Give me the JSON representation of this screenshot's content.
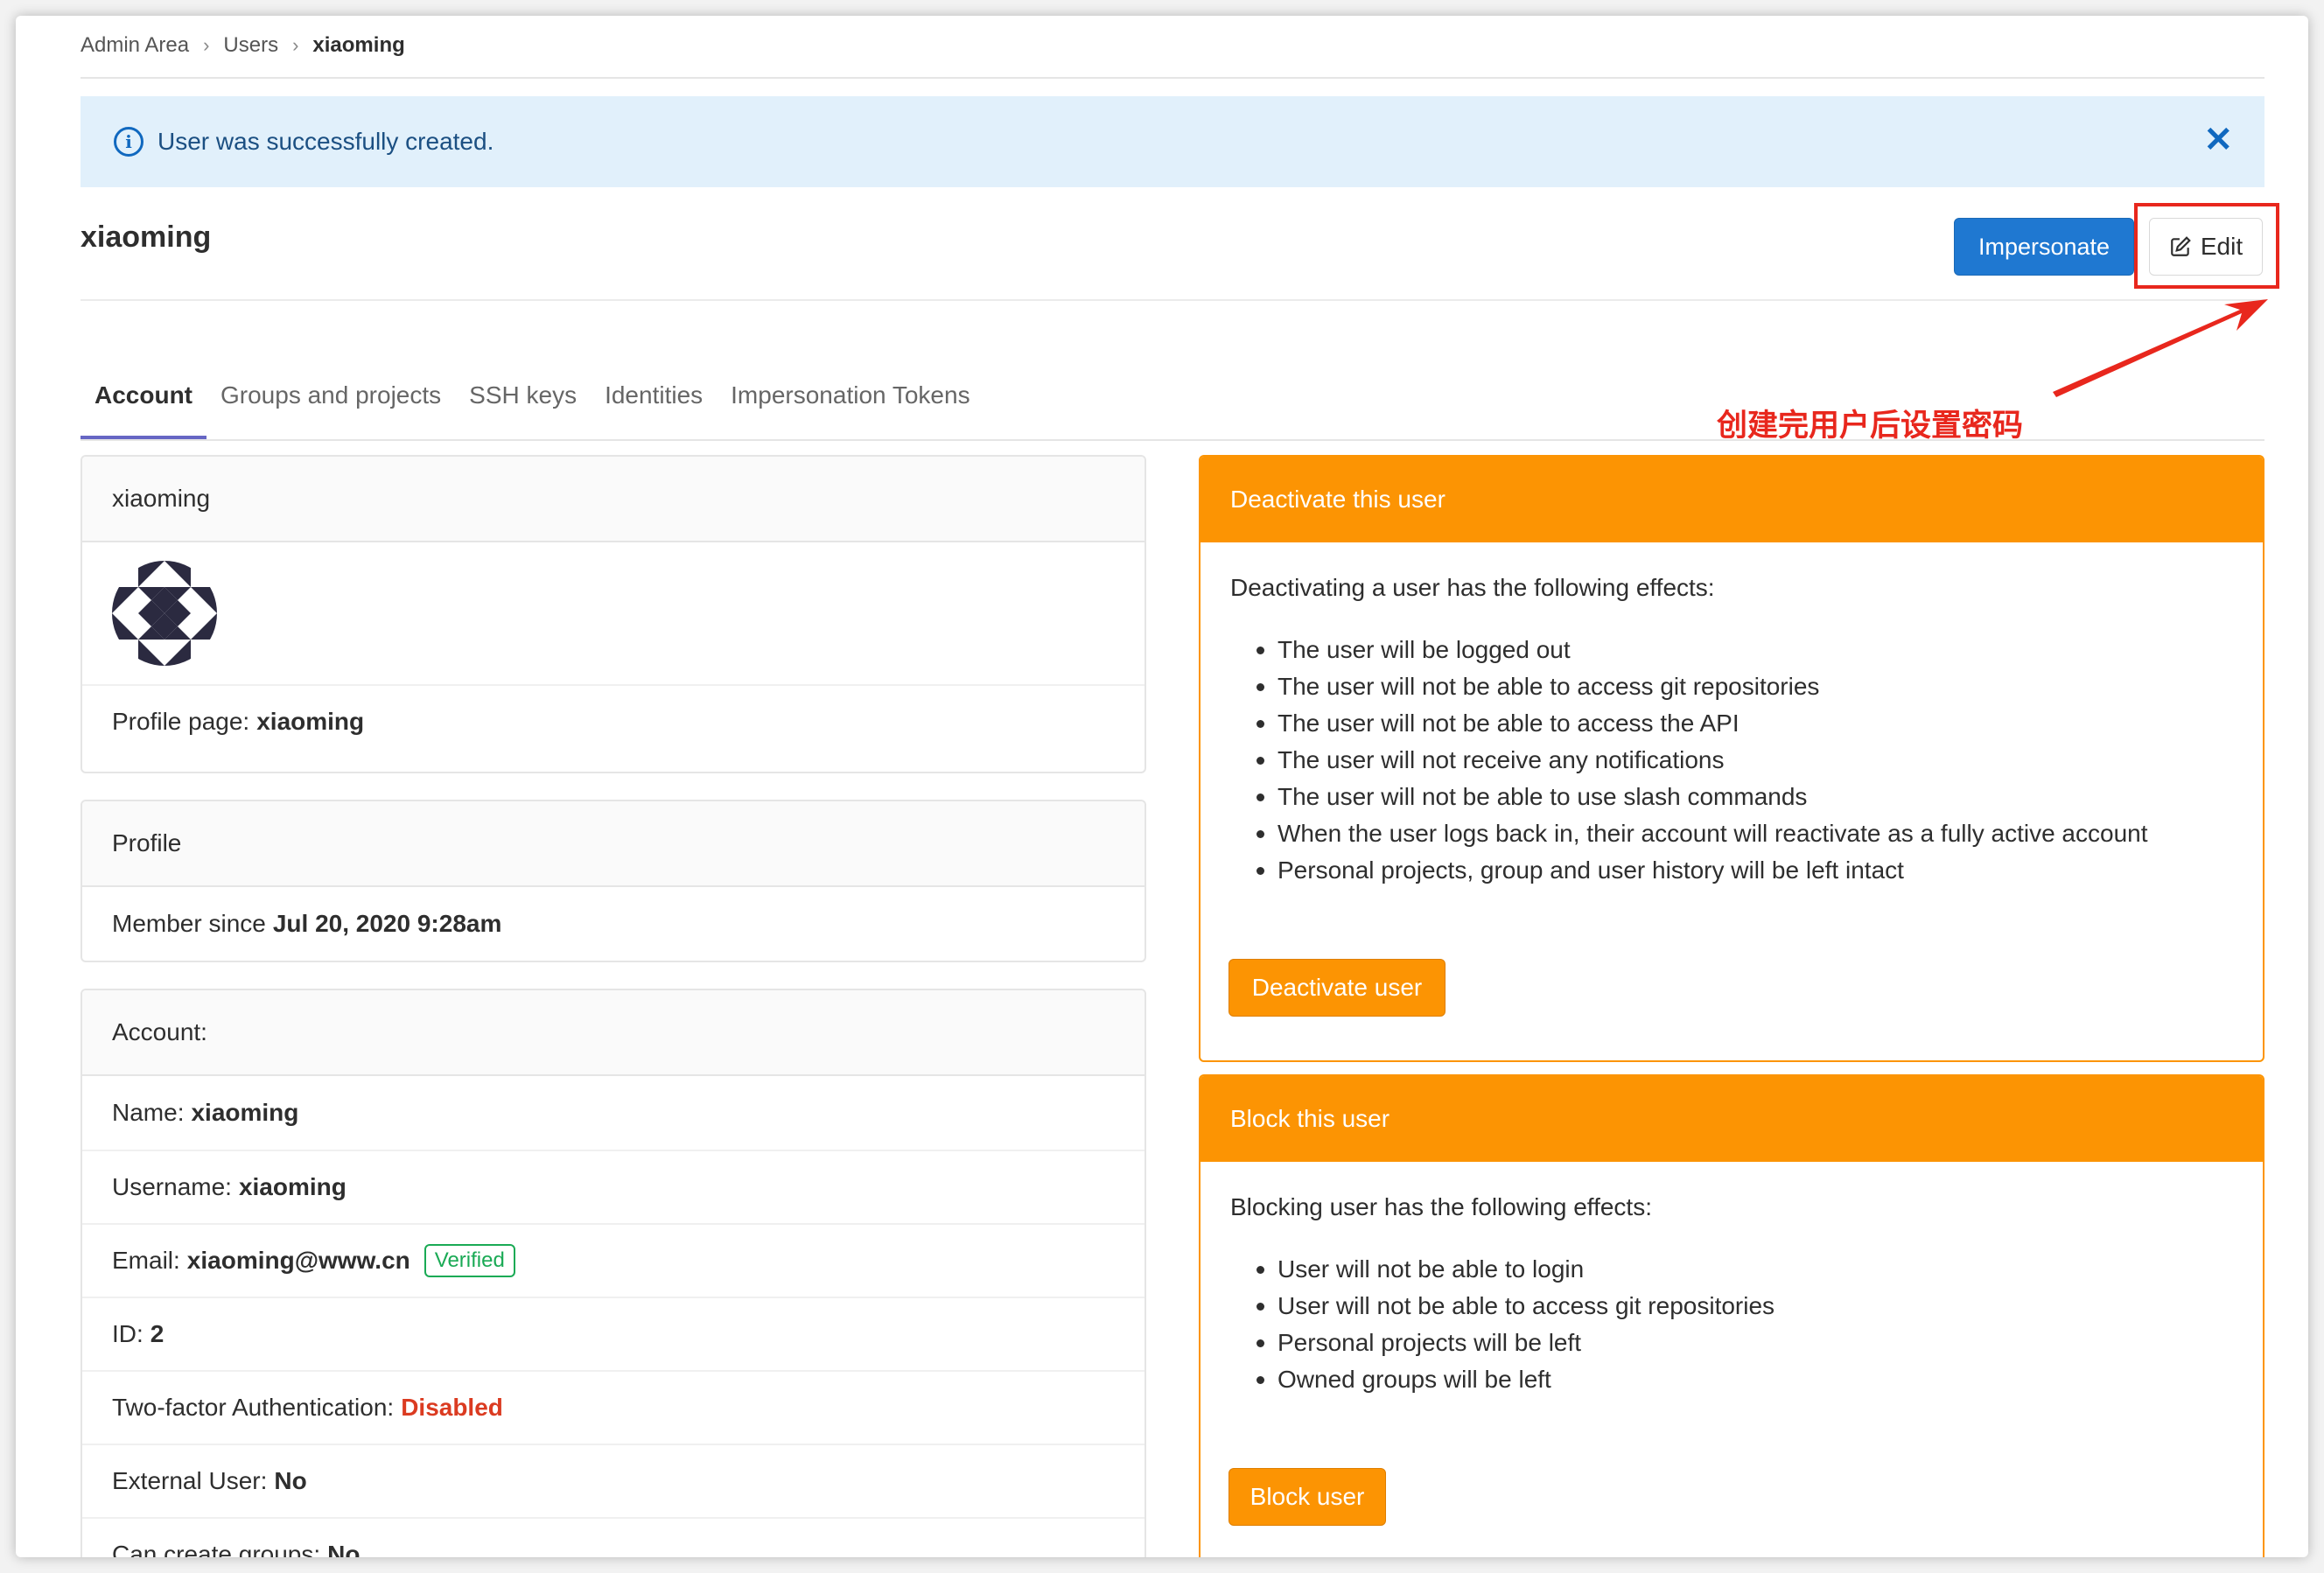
{
  "breadcrumb": {
    "items": [
      "Admin Area",
      "Users"
    ],
    "current": "xiaoming",
    "separator": "›"
  },
  "alert": {
    "message": "User was successfully created.",
    "close_symbol": "✕"
  },
  "header": {
    "title": "xiaoming",
    "impersonate_label": "Impersonate",
    "edit_label": "Edit"
  },
  "annotation": {
    "text": "创建完用户后设置密码",
    "color": "#e8271d"
  },
  "tabs": [
    "Account",
    "Groups and projects",
    "SSH keys",
    "Identities",
    "Impersonation Tokens"
  ],
  "user_card": {
    "header": "xiaoming",
    "profile_label": "Profile page:",
    "profile_value": "xiaoming"
  },
  "profile_card": {
    "header": "Profile",
    "member_since_label": "Member since",
    "member_since_value": "Jul 20, 2020 9:28am"
  },
  "account_card": {
    "header": "Account:",
    "name_label": "Name:",
    "name_value": "xiaoming",
    "username_label": "Username:",
    "username_value": "xiaoming",
    "email_label": "Email:",
    "email_value": "xiaoming@www.cn",
    "verified_badge": "Verified",
    "id_label": "ID:",
    "id_value": "2",
    "two_factor_label": "Two-factor Authentication:",
    "two_factor_value": "Disabled",
    "external_label": "External User:",
    "external_value": "No",
    "create_groups_label": "Can create groups:",
    "create_groups_value": "No"
  },
  "deactivate_card": {
    "header": "Deactivate this user",
    "lead": "Deactivating a user has the following effects:",
    "effects": [
      "The user will be logged out",
      "The user will not be able to access git repositories",
      "The user will not be able to access the API",
      "The user will not receive any notifications",
      "The user will not be able to use slash commands",
      "When the user logs back in, their account will reactivate as a fully active account",
      "Personal projects, group and user history will be left intact"
    ],
    "button_label": "Deactivate user"
  },
  "block_card": {
    "header": "Block this user",
    "lead": "Blocking user has the following effects:",
    "effects": [
      "User will not be able to login",
      "User will not be able to access git repositories",
      "Personal projects will be left",
      "Owned groups will be left"
    ],
    "button_label": "Block user"
  },
  "colors": {
    "primary": "#1f78d1",
    "warning": "#fc9403",
    "success": "#1aaa55",
    "danger": "#db3b21",
    "info_bg": "#e1f0fb",
    "tab_active": "#6666c4"
  },
  "icons": {
    "alert": "info-circle-icon",
    "close": "close-icon",
    "edit": "pencil-square-icon",
    "avatar": "identicon"
  }
}
